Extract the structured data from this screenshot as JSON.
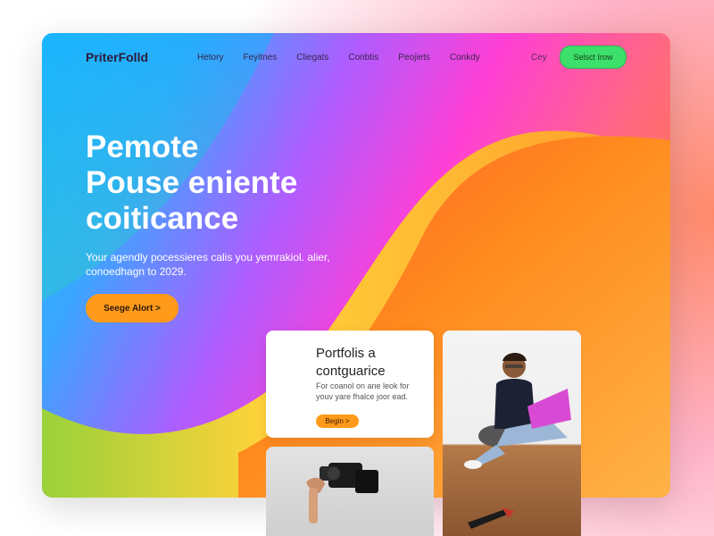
{
  "nav": {
    "logo": "PriterFolld",
    "links": [
      "Hetory",
      "Feyitnes",
      "Cliegats",
      "Conbtis",
      "Peojiets",
      "Conkdy"
    ],
    "login": "Cey",
    "cta": "Selsct Irow"
  },
  "hero": {
    "title_lines": [
      "Pemote",
      "Pouse eniente",
      "coiticance"
    ],
    "subtitle": "Your agendly pocessieres calis you yemrakiol. alier, conoedhagn to 2029.",
    "cta": "Seege Alort >"
  },
  "card": {
    "title": "Portfolis a contguarice",
    "text": "For coanol on ane leok for youv yare fhalce joor ead.",
    "button": "Begin >"
  },
  "images": {
    "person": "person-with-laptop-photo",
    "camera": "camera-photo"
  },
  "colors": {
    "nav_cta": "#3ce06a",
    "accent_orange": "#ff9a1a"
  }
}
